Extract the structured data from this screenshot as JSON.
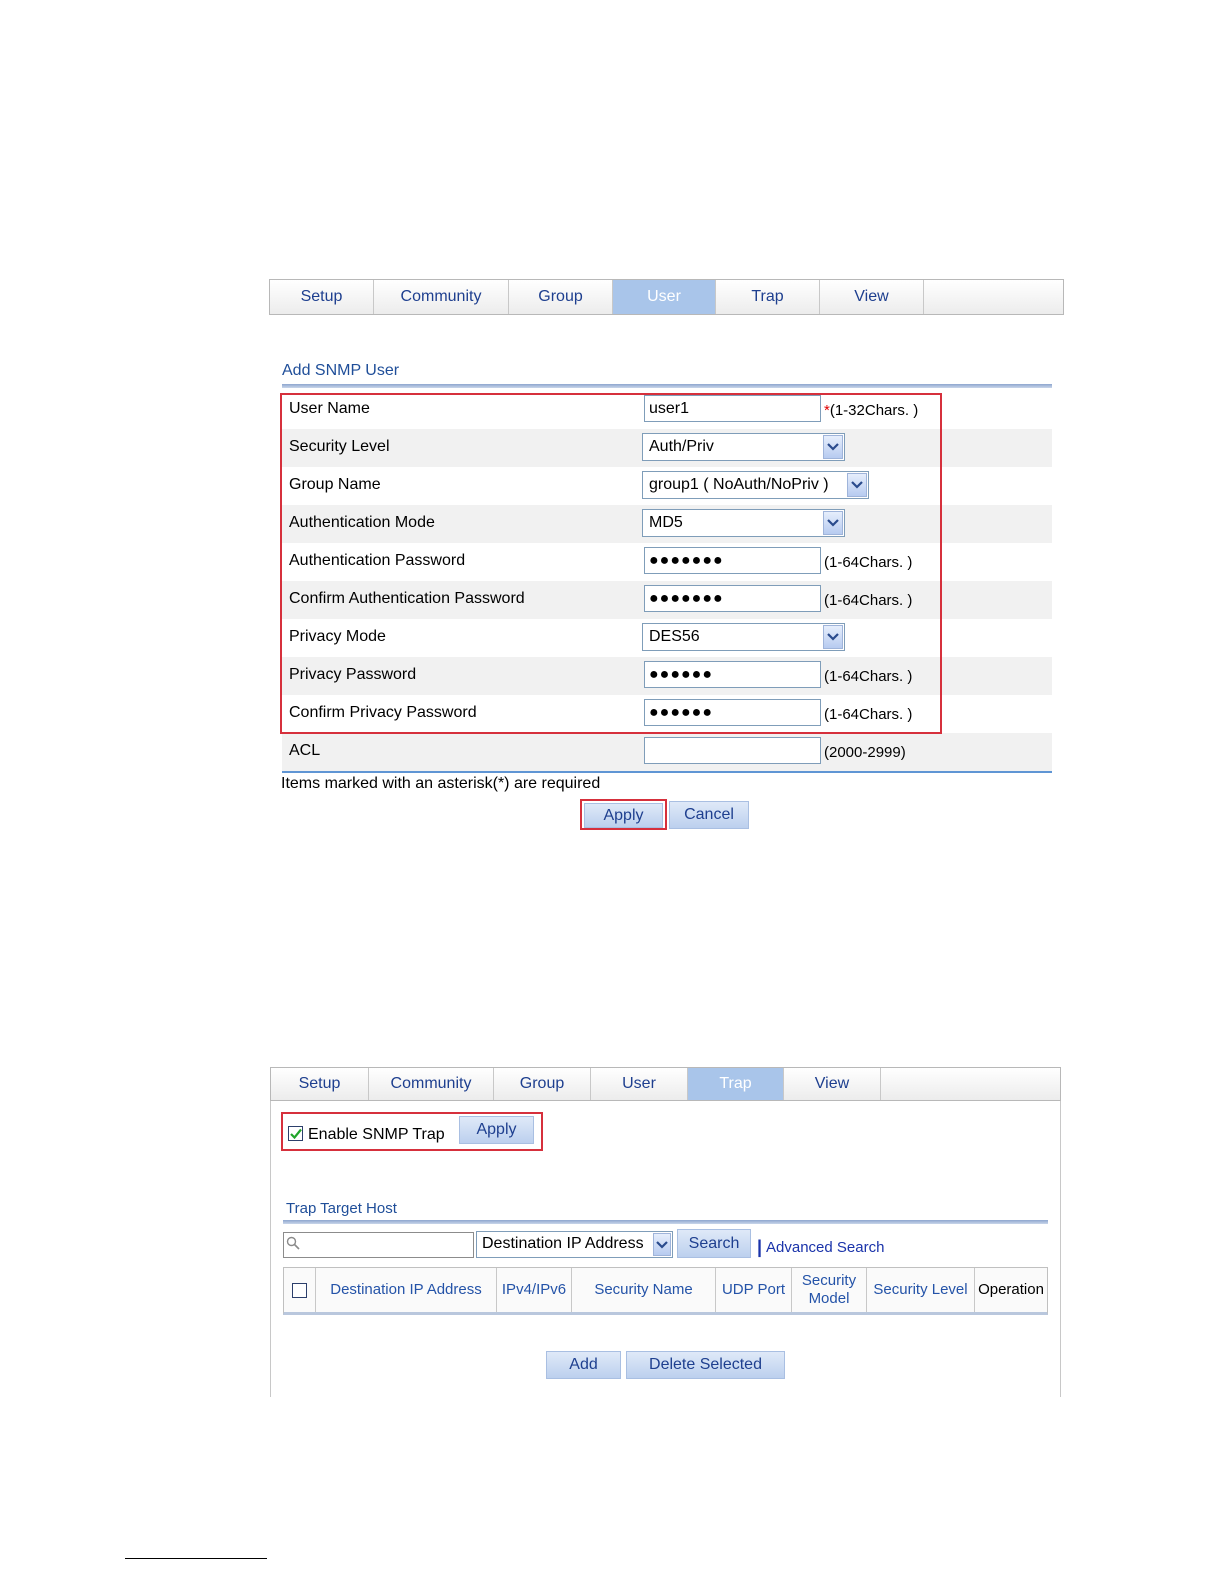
{
  "top_panel": {
    "tabs": [
      "Setup",
      "Community",
      "Group",
      "User",
      "Trap",
      "View"
    ],
    "active_tab": "User",
    "section_title": "Add SNMP User",
    "rows": [
      {
        "label": "User Name",
        "type": "text",
        "value": "user1",
        "required": true,
        "hint": "(1-32Chars. )"
      },
      {
        "label": "Security Level",
        "type": "select",
        "value": "Auth/Priv"
      },
      {
        "label": "Group Name",
        "type": "select",
        "value": "group1 ( NoAuth/NoPriv )"
      },
      {
        "label": "Authentication Mode",
        "type": "select",
        "value": "MD5"
      },
      {
        "label": "Authentication Password",
        "type": "password",
        "value": "●●●●●●●",
        "hint": "(1-64Chars. )"
      },
      {
        "label": "Confirm Authentication Password",
        "type": "password",
        "value": "●●●●●●●",
        "hint": "(1-64Chars. )"
      },
      {
        "label": "Privacy Mode",
        "type": "select",
        "value": "DES56"
      },
      {
        "label": "Privacy Password",
        "type": "password",
        "value": "●●●●●●",
        "hint": "(1-64Chars. )"
      },
      {
        "label": "Confirm Privacy Password",
        "type": "password",
        "value": "●●●●●●",
        "hint": "(1-64Chars. )"
      },
      {
        "label": "ACL",
        "type": "text",
        "value": "",
        "hint": "(2000-2999)"
      }
    ],
    "required_note": "Items marked with an asterisk(*) are required",
    "asterisk": "*",
    "apply_label": "Apply",
    "cancel_label": "Cancel"
  },
  "bottom_panel": {
    "tabs": [
      "Setup",
      "Community",
      "Group",
      "User",
      "Trap",
      "View"
    ],
    "active_tab": "Trap",
    "enable_trap_label": "Enable SNMP Trap",
    "enable_trap_checked": true,
    "apply_label": "Apply",
    "section_title": "Trap Target Host",
    "search": {
      "value": "",
      "field_select": "Destination IP Address",
      "search_label": "Search",
      "separator": "|",
      "advanced_label": "Advanced Search"
    },
    "table_headers": [
      "Destination IP Address",
      "IPv4/IPv6",
      "Security Name",
      "UDP Port",
      "Security Model",
      "Security Level",
      "Operation"
    ],
    "add_label": "Add",
    "delete_label": "Delete Selected"
  },
  "colors": {
    "tab_active": "#a9c5ea",
    "link": "#1f4e99",
    "highlight": "#d6303c"
  }
}
